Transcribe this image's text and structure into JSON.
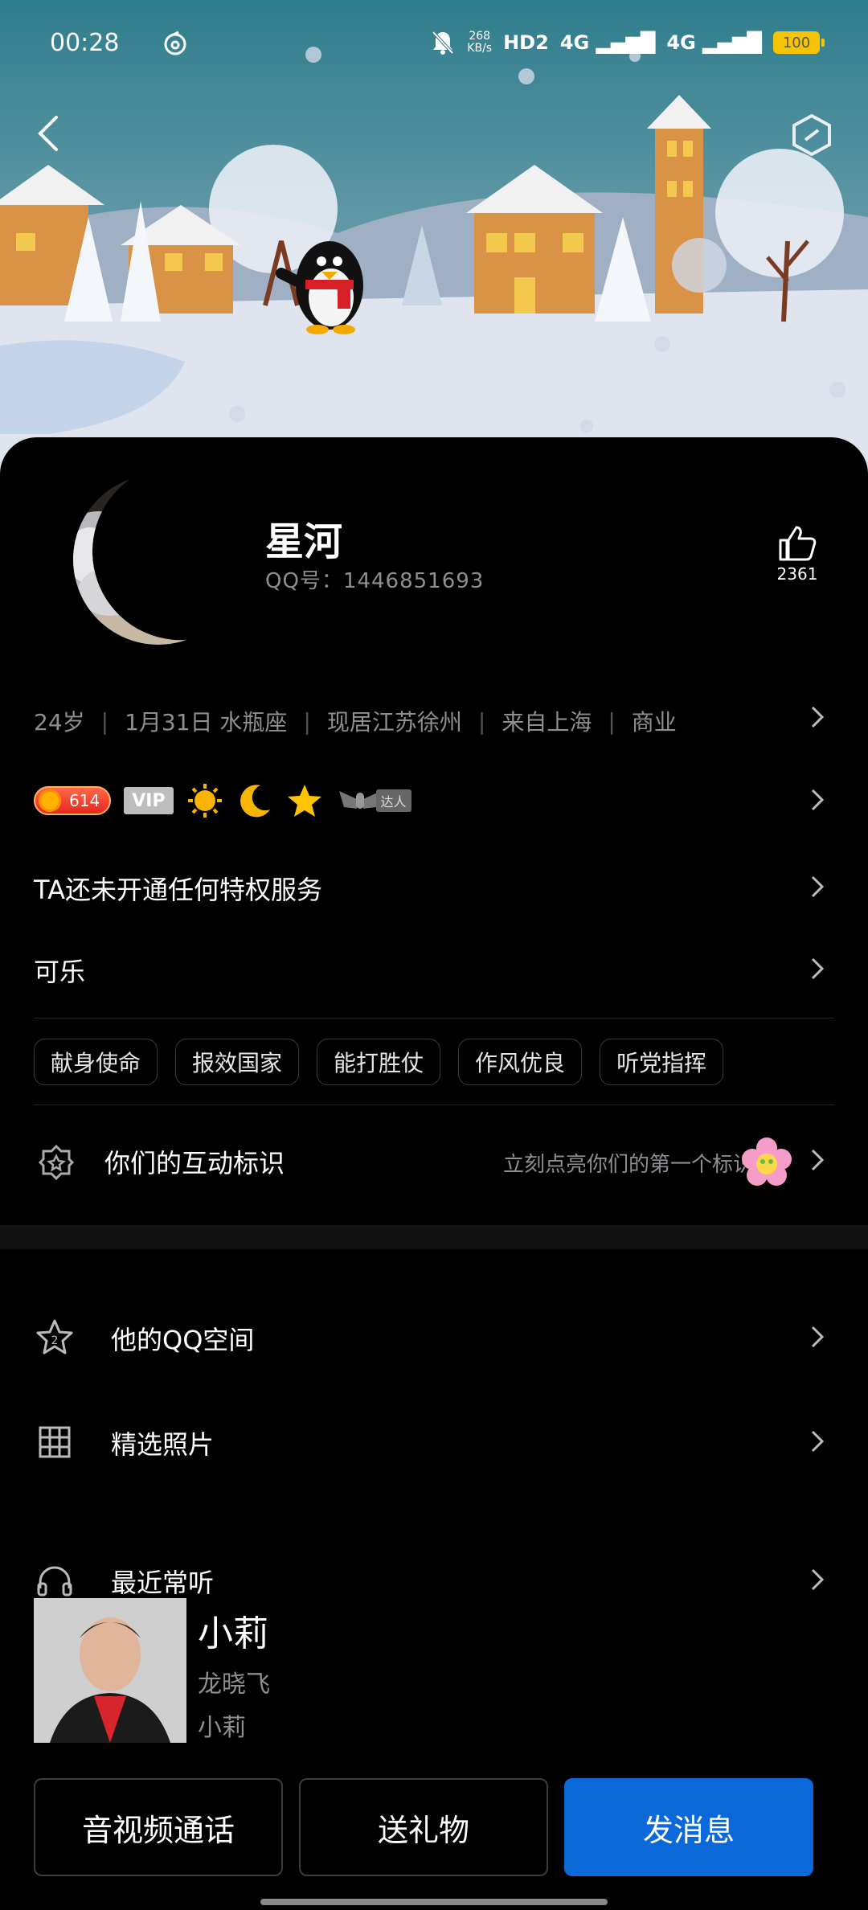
{
  "status_bar": {
    "time": "00:28",
    "net_speed_value": "268",
    "net_speed_unit": "KB/s",
    "hd_label": "HD2",
    "sig1_label": "4G",
    "sig2_label": "4G",
    "battery": "100"
  },
  "profile": {
    "nickname": "星河",
    "qq_id": "QQ号：1446851693",
    "like_count": "2361",
    "info": [
      "24岁",
      "1月31日 水瓶座",
      "现居江苏徐州",
      "来自上海",
      "商业"
    ]
  },
  "badges": {
    "level": "614",
    "vip": "VIP",
    "talent": "达人"
  },
  "rows": {
    "privilege": "TA还未开通任何特权服务",
    "signature": "可乐"
  },
  "tags": [
    "献身使命",
    "报效国家",
    "能打胜仗",
    "作风优良",
    "听党指挥"
  ],
  "interaction": {
    "title": "你们的互动标识",
    "hint": "立刻点亮你们的第一个标识"
  },
  "menu": {
    "qzone": "他的QQ空间",
    "photos": "精选照片",
    "music": "最近常听"
  },
  "music": {
    "song": "小莉",
    "artist": "龙晓飞",
    "album": "小莉"
  },
  "actions": {
    "call": "音视频通话",
    "gift": "送礼物",
    "message": "发消息"
  },
  "colors": {
    "primary_button": "#0a68d8",
    "secondary_text": "#8e8e93",
    "battery": "#f6c400"
  }
}
